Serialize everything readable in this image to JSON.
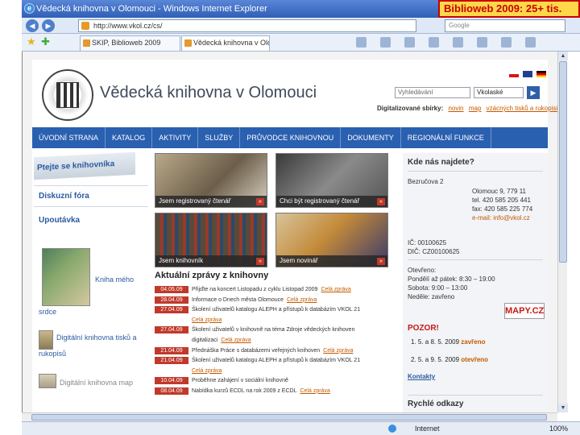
{
  "browser": {
    "title": "Vědecká knihovna v Olomouci - Windows Internet Explorer",
    "url": "http://www.vkol.cz/cs/",
    "search_placeholder": "Google",
    "tabs": [
      {
        "label": "SKIP, Biblioweb 2009"
      },
      {
        "label": "Vědecká knihovna v Olom..."
      }
    ],
    "status_zone": "Internet",
    "zoom": "100%"
  },
  "overlay": {
    "label": "Biblioweb 2009: 25+ tis."
  },
  "site": {
    "title": "Vědecká knihovna v Olomouci",
    "search_placeholder": "Vyhledávání",
    "search_scope": "Vkolaské",
    "go_label": "▶",
    "digi_label": "Digitalizované sbírky:",
    "digi_links": [
      "novin",
      "map",
      "vzácných tisků a rukopisů"
    ]
  },
  "nav": {
    "items": [
      "ÚVODNÍ STRANA",
      "KATALOG",
      "AKTIVITY",
      "SLUŽBY",
      "PRŮVODCE KNIHOVNOU",
      "DOKUMENTY",
      "REGIONÁLNÍ FUNKCE"
    ]
  },
  "left": {
    "ask_label": "Ptejte se knihovníka",
    "forum_label": "Diskuzní fóra",
    "tips_label": "Upoutávka",
    "book_link": "Kniha mého",
    "book_link2": "srdce",
    "digi_link": "Digitální knihovna tisků a",
    "digi_link2": "rukopisů",
    "library_link": "Digitální knihovna map"
  },
  "tiles": [
    {
      "caption": "Jsem registrovaný čtenář"
    },
    {
      "caption": "Chci být registrovaný čtenář"
    },
    {
      "caption": "Jsem knihovník"
    },
    {
      "caption": "Jsem novinář"
    }
  ],
  "news": {
    "heading": "Aktuální zprávy z knihovny",
    "items": [
      {
        "date": "04.05.09",
        "text": "Přijďte na koncert Listopadu z cyklu Listopad 2009",
        "more": "Celá zpráva"
      },
      {
        "date": "28.04.09",
        "text": "Informace o Dnech města Olomouce",
        "more": "Celá zpráva"
      },
      {
        "date": "27.04.09",
        "text": "Školení uživatelů katalogu ALEPH a přístupů k databázím VKOL 21",
        "more": ""
      },
      {
        "date": "",
        "text": "Celá zpráva",
        "more": ""
      },
      {
        "date": "27.04.09",
        "text": "Školení uživatelů v knihovně na téma Zdroje vědeckých knihoven",
        "more": ""
      },
      {
        "date": "",
        "text": "digitalizaci",
        "more": "Celá zpráva"
      },
      {
        "date": "21.04.09",
        "text": "Přednáška Práce s databázemi veřejných knihoven",
        "more": "Celá zpráva"
      },
      {
        "date": "21.04.09",
        "text": "Školení uživatelů katalogu ALEPH a přístupů k databázím VKOL 21",
        "more": ""
      },
      {
        "date": "",
        "text": "Celá zpráva",
        "more": ""
      },
      {
        "date": "10.04.09",
        "text": "Proběhne zahájení v sociální knihovně",
        "more": ""
      },
      {
        "date": "08.04.09",
        "text": "Nabídka kurzů ECDL na rok 2009 z ECDL",
        "more": "Celá zpráva"
      }
    ]
  },
  "right": {
    "where_title": "Kde nás najdete?",
    "street": "Bezručova 2",
    "contact": [
      "Olomouc 9, 779 11",
      "tel. 420 585 205 441",
      "fax: 420 585 225 774",
      "e-mail: info@vkol.cz"
    ],
    "ic": "IČ: 00100625",
    "dic": "DIČ: CZ00100625",
    "hours_title": "Otevřeno:",
    "hours": [
      "Pondělí až pátek: 8:30 – 19:00",
      "Sobota: 9:00 – 13:00",
      "Neděle: zavřeno"
    ],
    "mapy_label": "MAPY.CZ",
    "pozor": "POZOR!",
    "warnings": [
      {
        "text": "1. 5. a 8. 5. 2009",
        "status": "zavřeno"
      },
      {
        "text": "2. 5. a 9. 5. 2009",
        "status": "otevřeno"
      }
    ],
    "contact_link": "Kontakty",
    "bottom_title": "Rychlé odkazy"
  }
}
